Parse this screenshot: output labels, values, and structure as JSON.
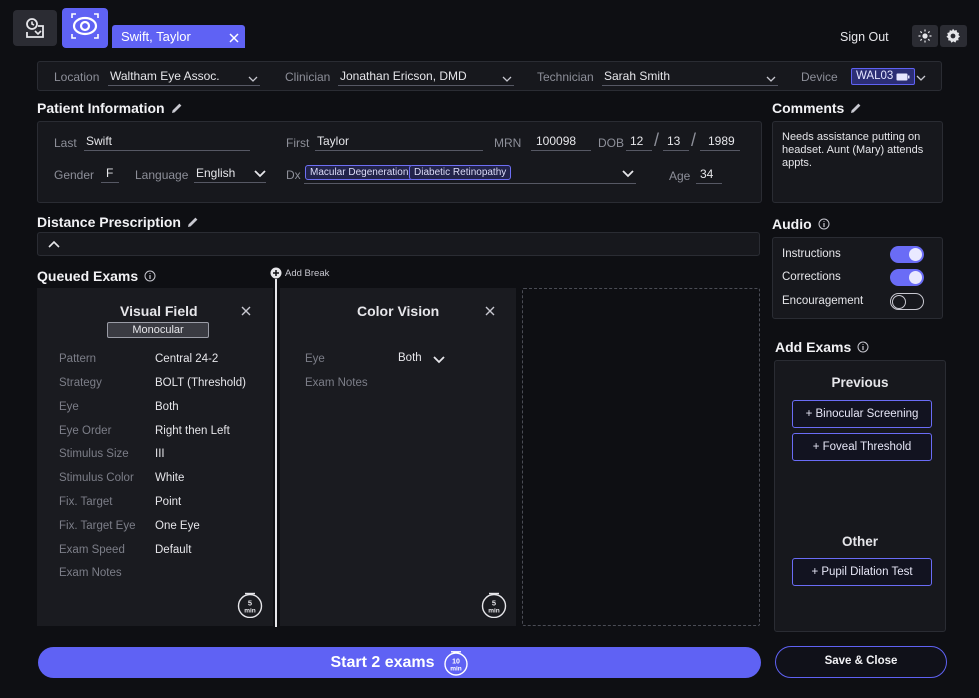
{
  "top_bar": {
    "patient_tab_label": "Swift, Taylor",
    "sign_out_label": "Sign Out",
    "icons": [
      "clock-arrow-icon",
      "eye-target-icon",
      "close-icon",
      "sun-icon",
      "gear-icon"
    ]
  },
  "location_bar": {
    "location_label": "Location",
    "location_value": "Waltham Eye Assoc.",
    "clinician_label": "Clinician",
    "clinician_value": "Jonathan Ericson, DMD",
    "technician_label": "Technician",
    "technician_value": "Sarah Smith",
    "device_label": "Device",
    "device_value": "WAL03"
  },
  "patient_info": {
    "title": "Patient Information",
    "last_label": "Last",
    "last_value": "Swift",
    "first_label": "First",
    "first_value": "Taylor",
    "mrn_label": "MRN",
    "mrn_value": "100098",
    "dob_label": "DOB",
    "dob_month": "12",
    "dob_day": "13",
    "dob_year": "1989",
    "gender_label": "Gender",
    "gender_value": "F",
    "language_label": "Language",
    "language_value": "English",
    "dx_label": "Dx",
    "dx_tags": [
      "Macular Degeneration",
      "Diabetic Retinopathy"
    ],
    "age_label": "Age",
    "age_value": "34"
  },
  "comments": {
    "title": "Comments",
    "text": "Needs assistance putting on headset. Aunt (Mary) attends appts."
  },
  "distance_rx": {
    "title": "Distance Prescription"
  },
  "audio": {
    "title": "Audio",
    "items": [
      {
        "label": "Instructions",
        "on": true
      },
      {
        "label": "Corrections",
        "on": true
      },
      {
        "label": "Encouragement",
        "on": false
      }
    ]
  },
  "queued": {
    "title": "Queued Exams",
    "add_break_label": "Add Break",
    "exams": [
      {
        "title": "Visual Field",
        "badge": "Monocular",
        "rows": [
          {
            "label": "Pattern",
            "value": "Central 24-2"
          },
          {
            "label": "Strategy",
            "value": "BOLT (Threshold)"
          },
          {
            "label": "Eye",
            "value": "Both"
          },
          {
            "label": "Eye Order",
            "value": "Right then Left"
          },
          {
            "label": "Stimulus Size",
            "value": "III"
          },
          {
            "label": "Stimulus Color",
            "value": "White"
          },
          {
            "label": "Fix. Target",
            "value": "Point"
          },
          {
            "label": "Fix. Target Eye",
            "value": "One Eye"
          },
          {
            "label": "Exam Speed",
            "value": "Default"
          },
          {
            "label": "Exam Notes",
            "value": ""
          }
        ],
        "timer_value": "5",
        "timer_unit": "min"
      },
      {
        "title": "Color Vision",
        "rows": [
          {
            "label": "Eye",
            "value": "Both"
          },
          {
            "label": "Exam Notes",
            "value": ""
          }
        ],
        "timer_value": "5",
        "timer_unit": "min"
      }
    ]
  },
  "add_exams": {
    "title": "Add Exams",
    "previous_title": "Previous",
    "previous": [
      "+ Binocular Screening",
      "+ Foveal Threshold"
    ],
    "other_title": "Other",
    "other": [
      "+ Pupil Dilation Test"
    ]
  },
  "footer": {
    "start_label": "Start 2 exams",
    "start_timer_value": "10",
    "start_timer_unit": "min",
    "save_close_label": "Save & Close"
  },
  "colors": {
    "accent": "#5f62f4",
    "background": "#0e0f13",
    "panel": "#17181d"
  }
}
